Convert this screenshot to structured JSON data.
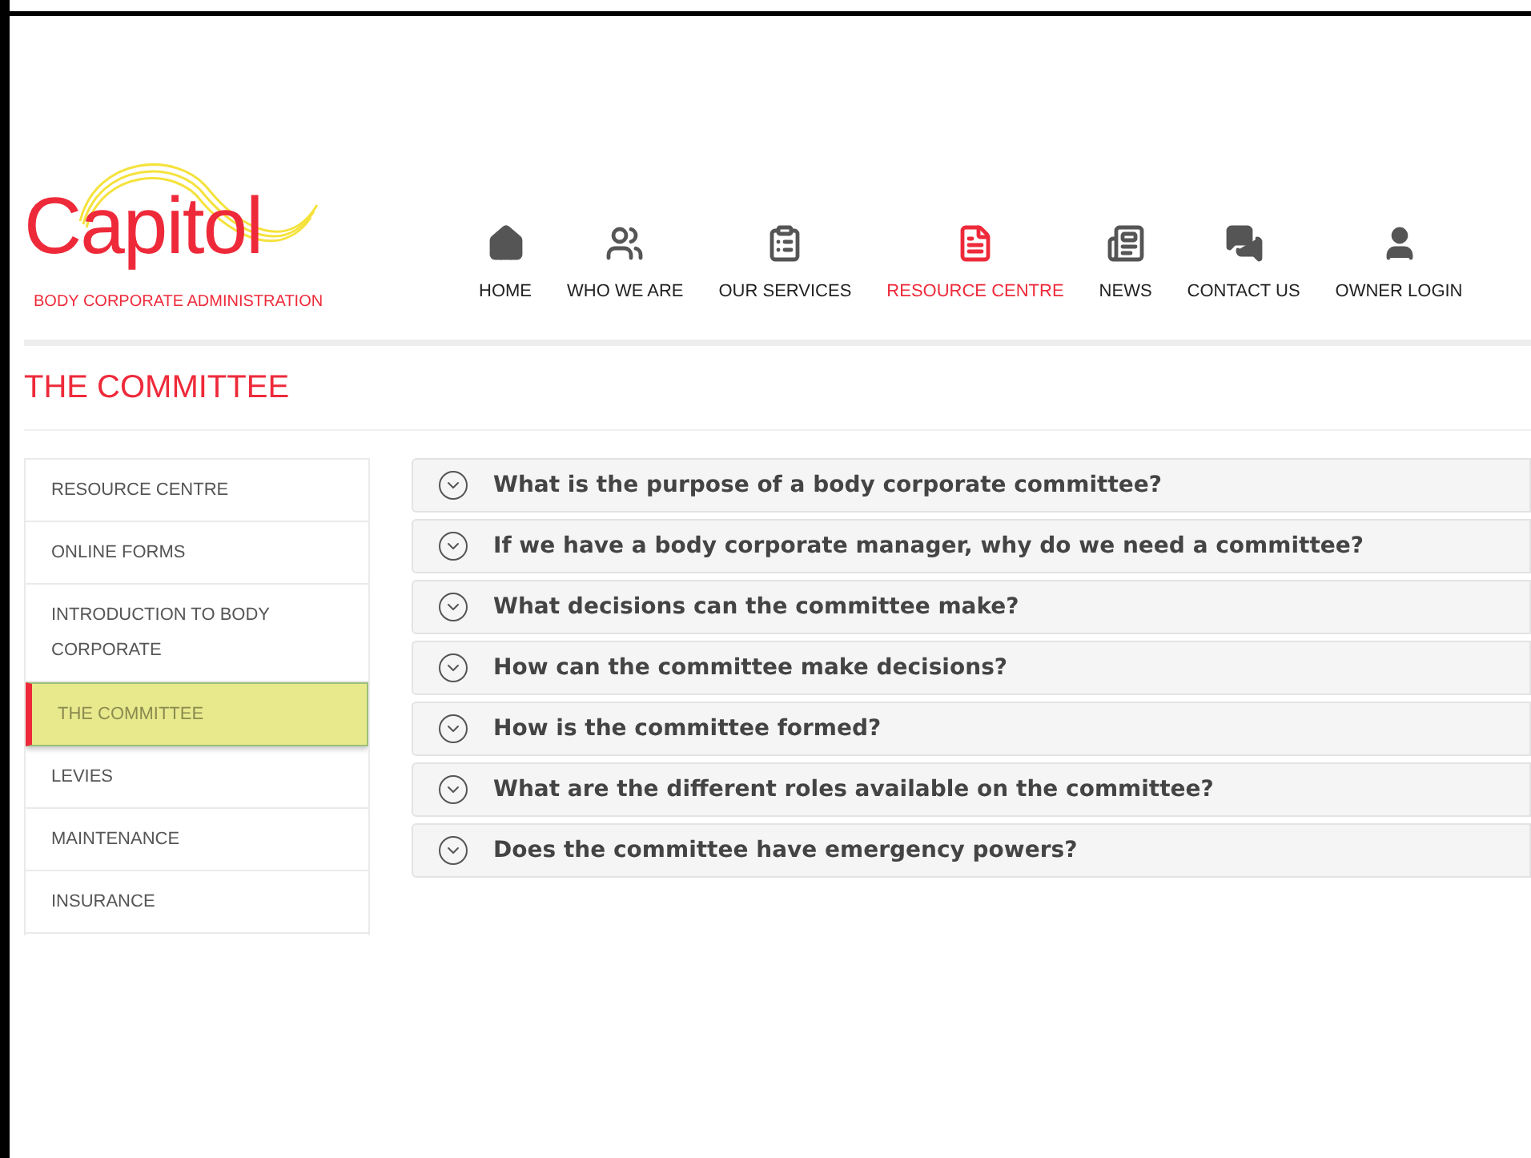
{
  "logo": {
    "name": "Capitol",
    "tagline": "BODY CORPORATE ADMINISTRATION"
  },
  "nav": [
    {
      "label": "HOME",
      "kind": "home",
      "selected": false
    },
    {
      "label": "WHO WE ARE",
      "kind": "users",
      "selected": false
    },
    {
      "label": "OUR SERVICES",
      "kind": "clipboard",
      "selected": false
    },
    {
      "label": "RESOURCE CENTRE",
      "kind": "document",
      "selected": true
    },
    {
      "label": "NEWS",
      "kind": "newspaper",
      "selected": false
    },
    {
      "label": "CONTACT US",
      "kind": "chat",
      "selected": false
    },
    {
      "label": "OWNER LOGIN",
      "kind": "user",
      "selected": false
    }
  ],
  "page_title": "THE COMMITTEE",
  "sidebar": {
    "items": [
      {
        "label": "RESOURCE CENTRE",
        "selected": false
      },
      {
        "label": "ONLINE FORMS",
        "selected": false
      },
      {
        "label": "INTRODUCTION TO BODY CORPORATE",
        "selected": false
      },
      {
        "label": "THE COMMITTEE",
        "selected": true
      },
      {
        "label": "LEVIES",
        "selected": false
      },
      {
        "label": "MAINTENANCE",
        "selected": false
      },
      {
        "label": "INSURANCE",
        "selected": false
      }
    ]
  },
  "faq": [
    {
      "question": "What is the purpose of a body corporate committee?",
      "expanded": false
    },
    {
      "question": "If we have a body corporate manager, why do we need a committee?",
      "expanded": false
    },
    {
      "question": "What decisions can the committee make?",
      "expanded": false
    },
    {
      "question": "How can the committee make decisions?",
      "expanded": false
    },
    {
      "question": "How is the committee formed?",
      "expanded": false
    },
    {
      "question": "What are the different roles available on the committee?",
      "expanded": false
    },
    {
      "question": "Does the committee have emergency powers?",
      "expanded": false
    }
  ]
}
